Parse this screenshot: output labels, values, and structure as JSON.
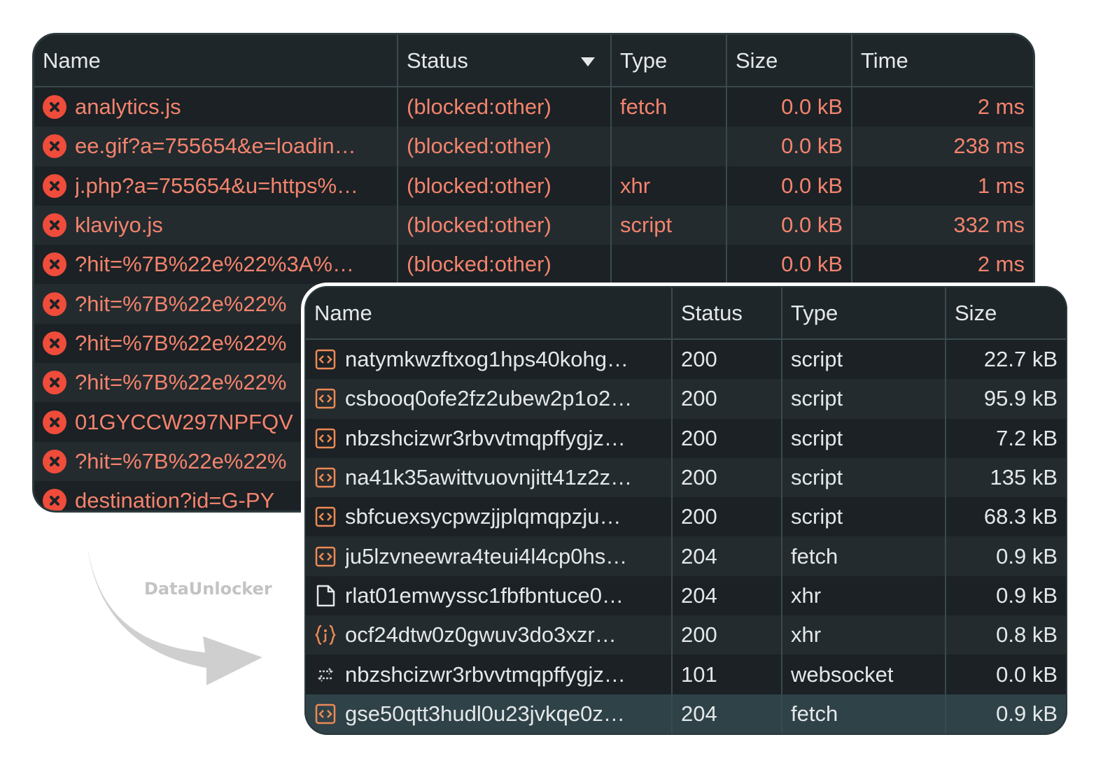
{
  "back_table": {
    "headers": {
      "name": "Name",
      "status": "Status",
      "type": "Type",
      "size": "Size",
      "time": "Time"
    },
    "rows": [
      {
        "name": "analytics.js",
        "status": "(blocked:other)",
        "type": "fetch",
        "size": "0.0 kB",
        "time": "2 ms"
      },
      {
        "name": "ee.gif?a=755654&e=loadin…",
        "status": "(blocked:other)",
        "type": "",
        "size": "0.0 kB",
        "time": "238 ms"
      },
      {
        "name": "j.php?a=755654&u=https%…",
        "status": "(blocked:other)",
        "type": "xhr",
        "size": "0.0 kB",
        "time": "1 ms"
      },
      {
        "name": "klaviyo.js",
        "status": "(blocked:other)",
        "type": "script",
        "size": "0.0 kB",
        "time": "332 ms"
      },
      {
        "name": "?hit=%7B%22e%22%3A%…",
        "status": "(blocked:other)",
        "type": "",
        "size": "0.0 kB",
        "time": "2 ms"
      },
      {
        "name": "?hit=%7B%22e%22%",
        "status": "",
        "type": "",
        "size": "",
        "time": ""
      },
      {
        "name": "?hit=%7B%22e%22%",
        "status": "",
        "type": "",
        "size": "",
        "time": ""
      },
      {
        "name": "?hit=%7B%22e%22%",
        "status": "",
        "type": "",
        "size": "",
        "time": ""
      },
      {
        "name": "01GYCCW297NPFQV",
        "status": "",
        "type": "",
        "size": "",
        "time": ""
      },
      {
        "name": "?hit=%7B%22e%22%",
        "status": "",
        "type": "",
        "size": "",
        "time": ""
      },
      {
        "name": "destination?id=G-PY",
        "status": "",
        "type": "",
        "size": "",
        "time": ""
      }
    ]
  },
  "front_table": {
    "headers": {
      "name": "Name",
      "status": "Status",
      "type": "Type",
      "size": "Size"
    },
    "rows": [
      {
        "icon": "script-icon",
        "name": "natymkwzftxog1hps40kohg…",
        "status": "200",
        "type": "script",
        "size": "22.7 kB"
      },
      {
        "icon": "script-icon",
        "name": "csbooq0ofe2fz2ubew2p1o2…",
        "status": "200",
        "type": "script",
        "size": "95.9 kB"
      },
      {
        "icon": "script-icon",
        "name": "nbzshcizwr3rbvvtmqpffygjz…",
        "status": "200",
        "type": "script",
        "size": "7.2 kB"
      },
      {
        "icon": "script-icon",
        "name": "na41k35awittvuovnjitt41z2z…",
        "status": "200",
        "type": "script",
        "size": "135 kB"
      },
      {
        "icon": "script-icon",
        "name": "sbfcuexsycpwzjjplqmqpzju…",
        "status": "200",
        "type": "script",
        "size": "68.3 kB"
      },
      {
        "icon": "script-icon",
        "name": "ju5lzvneewra4teui4l4cp0hs…",
        "status": "204",
        "type": "fetch",
        "size": "0.9 kB"
      },
      {
        "icon": "document-icon",
        "name": "rlat01emwyssc1fbfbntuce0…",
        "status": "204",
        "type": "xhr",
        "size": "0.9 kB"
      },
      {
        "icon": "json-icon",
        "name": "ocf24dtw0z0gwuv3do3xzr…",
        "status": "200",
        "type": "xhr",
        "size": "0.8 kB"
      },
      {
        "icon": "websocket-icon",
        "name": "nbzshcizwr3rbvvtmqpffygjz…",
        "status": "101",
        "type": "websocket",
        "size": "0.0 kB"
      },
      {
        "icon": "script-icon",
        "name": "gse50qtt3hudl0u23jvkqe0z…",
        "status": "204",
        "type": "fetch",
        "size": "0.9 kB"
      }
    ]
  },
  "watermark": "DataUnlocker",
  "colors": {
    "error": "#f4836e",
    "error_icon": "#ef4c3b",
    "script_icon": "#ee8a55",
    "panel_bg": "#1d2326"
  }
}
